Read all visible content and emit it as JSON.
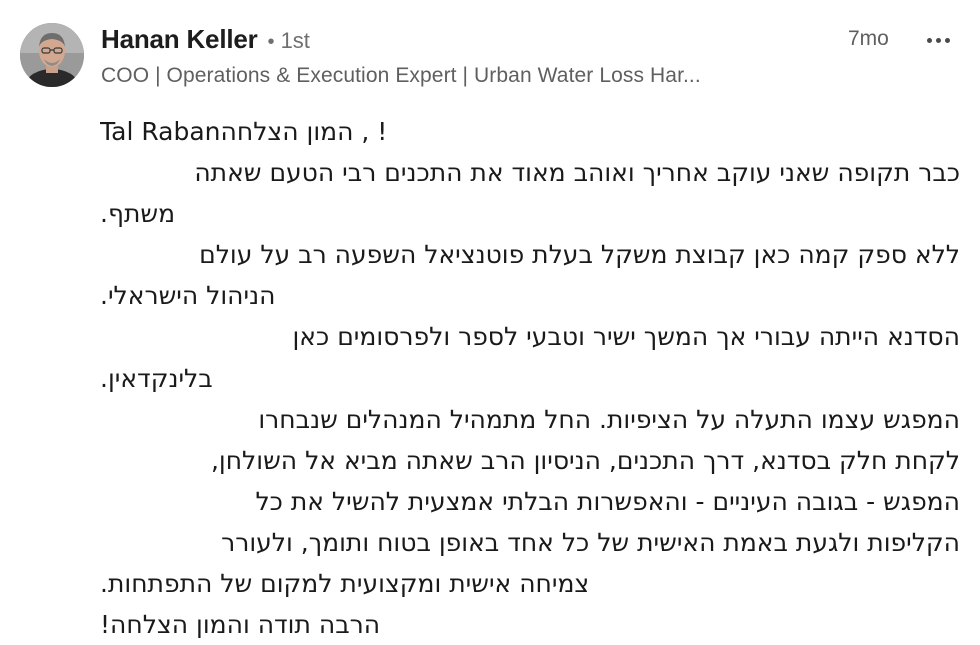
{
  "author": {
    "name": "Hanan Keller",
    "separator": "•",
    "degree": "1st",
    "headline": "COO | Operations & Execution Expert | Urban Water Loss Har..."
  },
  "meta": {
    "timestamp": "7mo",
    "more_icon": "more-horizontal-icon"
  },
  "comment": {
    "lines": [
      "Tal Rabanהמון הצלחה , !",
      "כבר תקופה שאני עוקב אחריך ואוהב מאוד את התכנים רבי הטעם שאתה",
      "משתף.",
      "ללא ספק קמה כאן קבוצת משקל בעלת פוטנציאל השפעה רב על עולם",
      "הניהול הישראלי.",
      "הסדנא הייתה עבורי אך המשך ישיר וטבעי לספר ולפרסומים כאן",
      "בלינקדאין.",
      "המפגש עצמו התעלה על הציפיות. החל מתמהיל המנהלים שנבחרו",
      "לקחת חלק בסדנא, דרך התכנים, הניסיון הרב שאתה מביא אל השולחן,",
      "המפגש - בגובה העיניים - והאפשרות הבלתי אמצעית להשיל את כל",
      "הקליפות ולגעת באמת האישית של כל אחד באופן בטוח ותומך, ולעורר",
      "צמיחה אישית ומקצועית למקום של התפתחות.",
      "הרבה תודה והמון הצלחה!"
    ]
  }
}
